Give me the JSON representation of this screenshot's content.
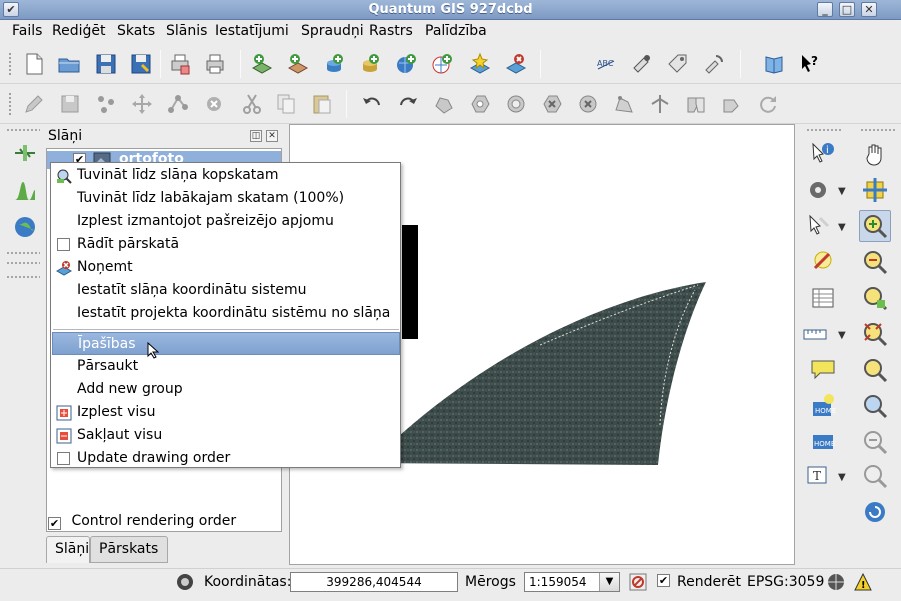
{
  "window": {
    "title": "Quantum GIS 927dcbd"
  },
  "menubar": [
    "Fails",
    "Rediģēt",
    "Skats",
    "Slānis",
    "Iestatījumi",
    "Spraudņi",
    "Rastrs",
    "Palīdzība"
  ],
  "layers_panel": {
    "title": "Slāņi",
    "layer_name": "ortofoto",
    "control_rendering_label": "Control rendering order",
    "tabs": [
      "Slāņi",
      "Pārskats"
    ]
  },
  "context_menu": {
    "items": [
      {
        "label": "Tuvināt līdz slāņa kopskatam",
        "icon": "zoom-layer-icon"
      },
      {
        "label": "Tuvināt līdz labākajam skatam (100%)",
        "icon": ""
      },
      {
        "label": "Izplest izmantojot pašreizējo apjomu",
        "icon": ""
      },
      {
        "label": "Rādīt pārskatā",
        "icon": "checkbox"
      },
      {
        "label": "Noņemt",
        "icon": "remove-layer-icon"
      },
      {
        "label": "Iestatīt slāņa koordinātu sistemu",
        "icon": ""
      },
      {
        "label": "Iestatīt projekta koordinātu sistēmu no slāņa",
        "icon": ""
      },
      {
        "label": "Īpašības",
        "icon": "",
        "highlighted": true
      },
      {
        "label": "Pārsaukt",
        "icon": ""
      },
      {
        "label": "Add new group",
        "icon": ""
      },
      {
        "label": "Izplest visu",
        "icon": "expand-all-icon"
      },
      {
        "label": "Sakļaut visu",
        "icon": "collapse-all-icon"
      },
      {
        "label": "Update drawing order",
        "icon": "checkbox"
      }
    ]
  },
  "statusbar": {
    "coordinates_label": "Koordinātas:",
    "coordinates_value": "399286,404544",
    "scale_label": "Mērogs",
    "scale_value": "1:159054",
    "render_label": "Renderēt",
    "epsg": "EPSG:3059"
  },
  "colors": {
    "titlebar": "#8aa6cc",
    "highlight": "#8fb0da",
    "imagery": "#3c4a4a"
  }
}
